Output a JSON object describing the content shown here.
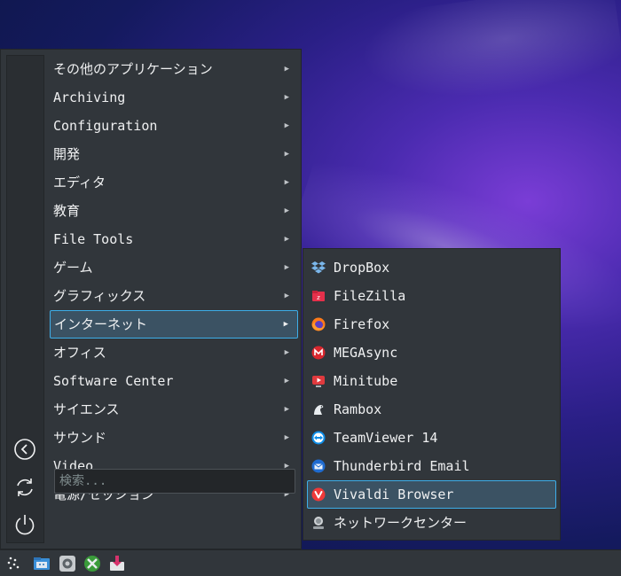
{
  "menu": {
    "items": [
      {
        "label": "その他のアプリケーション"
      },
      {
        "label": "Archiving"
      },
      {
        "label": "Configuration"
      },
      {
        "label": "開発"
      },
      {
        "label": "エディタ"
      },
      {
        "label": "教育"
      },
      {
        "label": "File Tools"
      },
      {
        "label": "ゲーム"
      },
      {
        "label": "グラフィックス"
      },
      {
        "label": "インターネット",
        "active": true
      },
      {
        "label": "オフィス"
      },
      {
        "label": "Software Center"
      },
      {
        "label": "サイエンス"
      },
      {
        "label": "サウンド"
      },
      {
        "label": "Video"
      },
      {
        "label": "電源/セッション"
      }
    ],
    "arrow": "▶",
    "side_buttons": [
      "back-icon",
      "refresh-icon",
      "power-icon"
    ]
  },
  "search": {
    "placeholder": "検索...",
    "value": ""
  },
  "submenu": {
    "items": [
      {
        "label": "DropBox",
        "icon": "dropbox-icon"
      },
      {
        "label": "FileZilla",
        "icon": "filezilla-icon"
      },
      {
        "label": "Firefox",
        "icon": "firefox-icon"
      },
      {
        "label": "MEGAsync",
        "icon": "megasync-icon"
      },
      {
        "label": "Minitube",
        "icon": "minitube-icon"
      },
      {
        "label": "Rambox",
        "icon": "rambox-icon"
      },
      {
        "label": "TeamViewer 14",
        "icon": "teamviewer-icon"
      },
      {
        "label": "Thunderbird Email",
        "icon": "thunderbird-icon"
      },
      {
        "label": "Vivaldi Browser",
        "icon": "vivaldi-icon",
        "active": true
      },
      {
        "label": "ネットワークセンター",
        "icon": "network-center-icon"
      }
    ]
  },
  "taskbar": {
    "icons": [
      "app-launcher-icon",
      "file-manager-icon",
      "settings-icon",
      "xfce-tools-icon",
      "installer-icon"
    ]
  },
  "colors": {
    "panel": "#31363b",
    "highlight": "#3b5263",
    "highlight_border": "#3daee9",
    "text": "#eff0f1"
  }
}
